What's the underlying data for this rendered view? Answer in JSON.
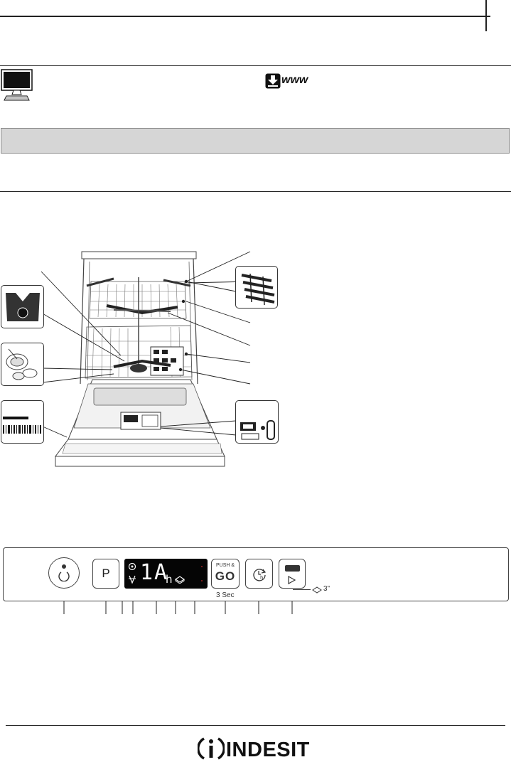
{
  "header_icons": {
    "monitor_icon": "monitor-icon",
    "download_icon": "download-icon",
    "www_label": "www"
  },
  "control_panel": {
    "program_key_label": "P",
    "display_digits": "1A",
    "display_unit": "h",
    "push_go_top": "PUSH &",
    "push_go_main": "GO",
    "push_go_caption": "3 Sec",
    "tablet_seconds": "3\""
  },
  "brand": {
    "name": "INDESIT"
  },
  "colors": {
    "rule": "#222222",
    "bar": "#d6d6d6",
    "display_bg": "#050505",
    "display_digits": "#ffffff"
  }
}
